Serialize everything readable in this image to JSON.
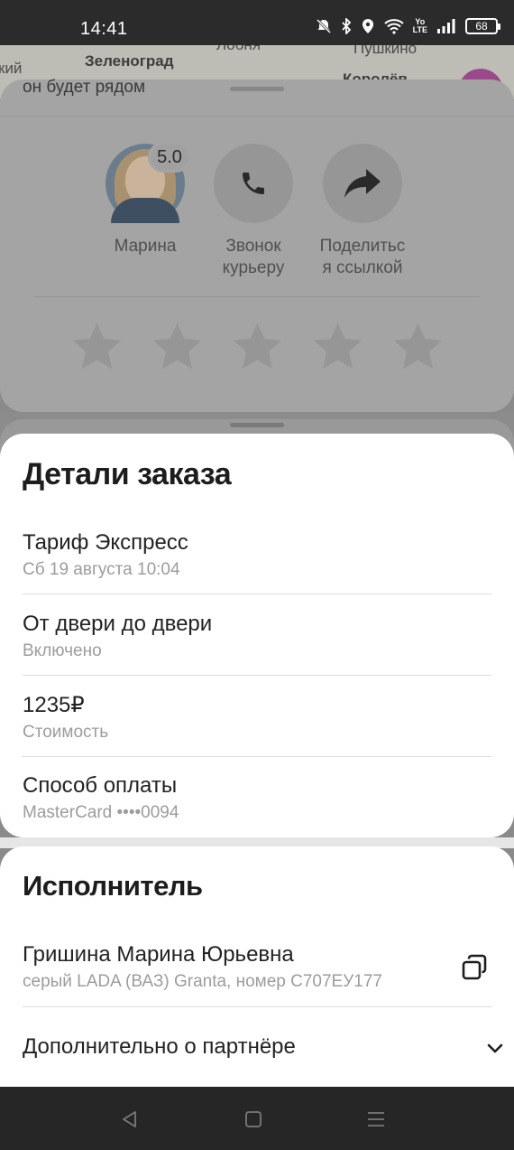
{
  "status_bar": {
    "time": "14:41",
    "battery": "68"
  },
  "map": {
    "labels": [
      "кий",
      "Зеленоград",
      "Лобня",
      "Пушкино",
      "Королёв"
    ],
    "partial_text": "он будет рядом"
  },
  "courier": {
    "name": "Марина",
    "rating": "5.0",
    "call_label_1": "Звонок",
    "call_label_2": "курьеру",
    "share_label_1": "Поделитьс",
    "share_label_2": "я ссылкой",
    "stars_count": 5
  },
  "order": {
    "title": "Детали заказа",
    "rows": [
      {
        "title": "Тариф Экспресс",
        "subtitle": "Сб 19 августа 10:04"
      },
      {
        "title": "От двери до двери",
        "subtitle": "Включено"
      },
      {
        "title": "1235₽",
        "subtitle": "Стоимость"
      },
      {
        "title": "Способ оплаты",
        "subtitle": "MasterCard ••••0094"
      }
    ]
  },
  "executor": {
    "title": "Исполнитель",
    "name": "Гришина Марина Юрьевна",
    "car": "серый LADA (ВАЗ) Granta, номер С707ЕУ177",
    "partner_label": "Дополнительно о партнёре"
  },
  "icons": {
    "phone": "phone-icon",
    "share": "share-arrow-icon",
    "copy": "copy-icon",
    "chevron": "chevron-down-icon",
    "nav_back": "back-triangle-icon",
    "nav_home": "home-square-icon",
    "nav_menu": "menu-lines-icon"
  }
}
